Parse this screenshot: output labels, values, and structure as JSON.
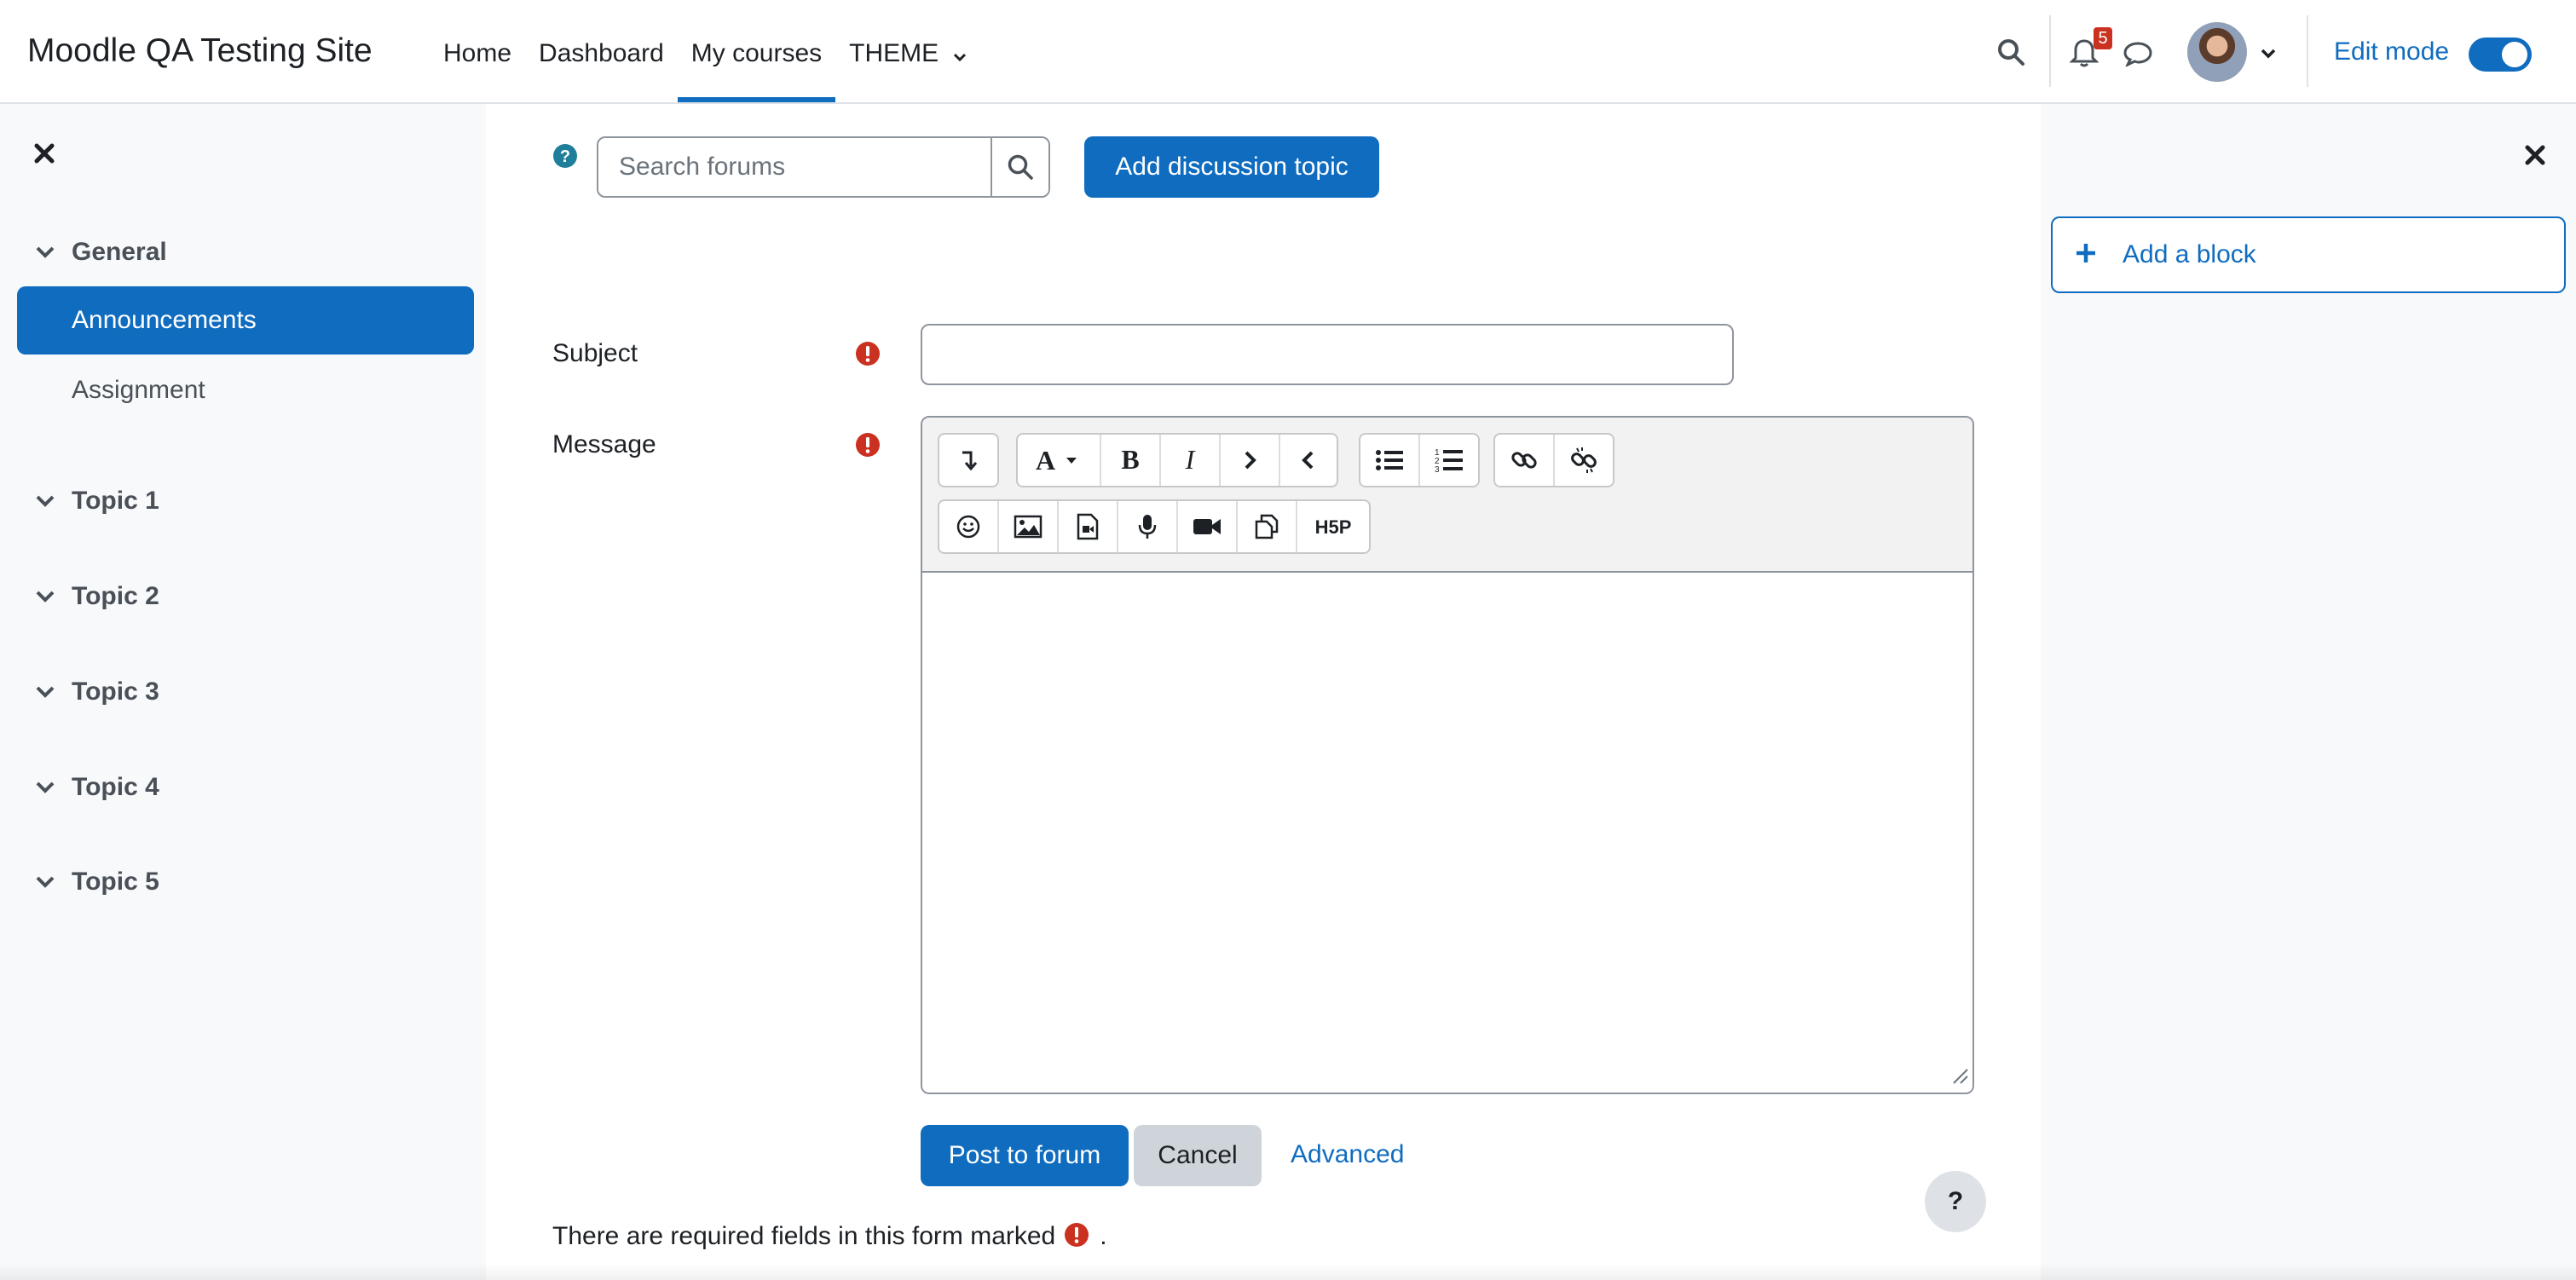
{
  "site_name": "Moodle QA Testing Site",
  "primary_nav": {
    "home": "Home",
    "dashboard": "Dashboard",
    "my_courses": "My courses",
    "theme": "THEME"
  },
  "header": {
    "notification_count": "5",
    "edit_mode_label": "Edit mode",
    "edit_mode_on": true
  },
  "course_index": {
    "general": "General",
    "items": [
      "Announcements",
      "Assignment"
    ],
    "topics": [
      "Topic 1",
      "Topic 2",
      "Topic 3",
      "Topic 4",
      "Topic 5"
    ]
  },
  "forum": {
    "search_placeholder": "Search forums",
    "add_topic_label": "Add discussion topic"
  },
  "form": {
    "subject_label": "Subject",
    "subject_value": "",
    "message_label": "Message",
    "message_value": "",
    "post_label": "Post to forum",
    "cancel_label": "Cancel",
    "advanced_label": "Advanced",
    "required_note": "There are required fields in this form marked",
    "required_note_end": "."
  },
  "editor_toolbar": {
    "row1": [
      "collapse-icon",
      "font-style-icon",
      "bold-icon",
      "italic-icon",
      "indent-icon",
      "outdent-icon",
      "unordered-list-icon",
      "ordered-list-icon",
      "link-icon",
      "unlink-icon"
    ],
    "row2": [
      "emoji-icon",
      "image-icon",
      "media-icon",
      "audio-record-icon",
      "video-record-icon",
      "manage-files-icon",
      "h5p-icon"
    ],
    "h5p_text": "H5P"
  },
  "blocks": {
    "add_block_label": "Add a block"
  },
  "help_button": "?",
  "colors": {
    "primary": "#0f6cbf",
    "danger": "#ca3120",
    "drawer_bg": "#f8f9fa"
  }
}
